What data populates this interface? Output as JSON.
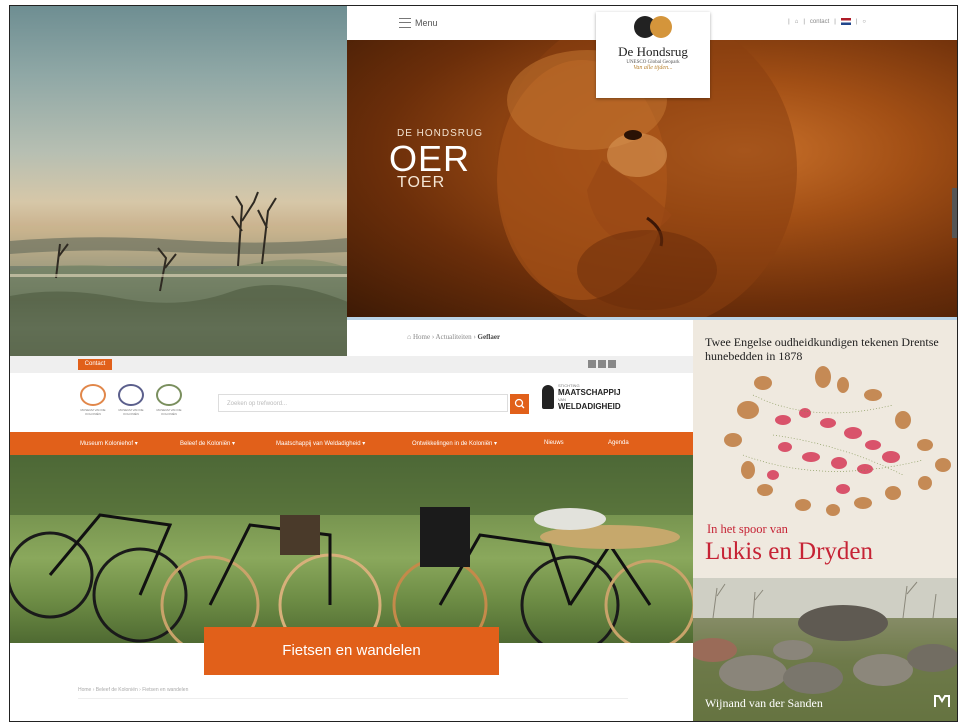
{
  "hondsrug": {
    "menu_label": "Menu",
    "util_links": [
      "|",
      "⌂",
      "|",
      "contact",
      "|"
    ],
    "logo_circle_text": "DE HONDSRUG",
    "logo_title": "De Hondsrug",
    "logo_subtitle": "UNESCO Global Geopark",
    "logo_tagline": "Van alle tijden...",
    "hero_small": "DE HONDSRUG",
    "hero_big": "OER",
    "hero_toer": "TOER",
    "breadcrumb": {
      "home": "Home",
      "sep": "›",
      "news": "Actualiteiten",
      "current": "Geflaer"
    }
  },
  "kolonien": {
    "contact_label": "Contact",
    "search_placeholder": "Zoeken op trefwoord...",
    "partner_logos": [
      {
        "text": "MUSEUM VAN DE KOLONIËN"
      },
      {
        "text": "MUSEUM VAN DE KOLONIËN"
      },
      {
        "text": "MUSEUM VAN DE KOLONIËN"
      }
    ],
    "weld_pre": "STICHTING",
    "weld_line1": "MAATSCHAPPIJ",
    "weld_line2": "VAN",
    "weld_line3": "WELDADIGHEID",
    "nav": [
      "Museum Koloniehof ▾",
      "Beleef de Koloniën ▾",
      "Maatschappij van Weldadigheid ▾",
      "Ontwikkelingen in de Koloniën ▾",
      "Nieuws",
      "Agenda"
    ],
    "cta": "Fietsen en wandelen",
    "breadcrumb": "Home › Beleef de Koloniën › Fietsen en wandelen"
  },
  "book": {
    "heading": "Twee Engelse oudheidkundigen tekenen Drentse hunebedden in 1878",
    "subtitle": "In het spoor van",
    "title": "Lukis en Dryden",
    "author": "Wijnand van der Sanden"
  },
  "colors": {
    "orange_accent": "#e1601a",
    "book_red": "#c62335",
    "hero_amber": "#a24f15"
  }
}
